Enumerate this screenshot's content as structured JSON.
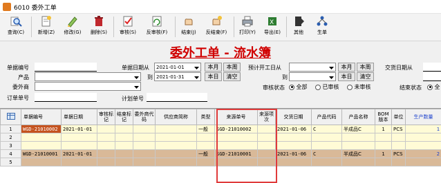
{
  "window": {
    "title": "6010 委外工单"
  },
  "toolbar": {
    "query": "查询(C)",
    "add": "新增(Z)",
    "edit": "修改(G)",
    "delete": "删除(S)",
    "audit": "审核(S)",
    "unaudit": "反审核(F)",
    "close": "结束(J)",
    "unclose": "反结束(F)",
    "print": "打印(Y)",
    "export": "导出(E)",
    "other": "其他",
    "generate": "生单"
  },
  "page_title": "委外工单 - 流水簿",
  "filters": {
    "order_no_label": "单据编号",
    "product_label": "产品",
    "vendor_label": "委外商",
    "sub_order_label": "订单单号",
    "date_from_label": "单据日期从",
    "date_from": "2021-01-01",
    "to_label": "到",
    "date_to": "2021-01-31",
    "this_month": "本月",
    "this_week": "本周",
    "today": "本日",
    "clear": "清空",
    "plan_no_label": "计划单号",
    "expected_start_label": "预计开工日从",
    "to_label2": "到",
    "this_month2": "本月",
    "this_week2": "本周",
    "today2": "本日",
    "clear2": "清空",
    "delivery_from_label": "交货日期从",
    "audit_status_label": "审核状态",
    "audit_options": [
      "全部",
      "已审核",
      "未审核"
    ],
    "close_status_label": "结束状态",
    "close_all": "全"
  },
  "grid": {
    "headers": [
      "单据编号",
      "单据日期",
      "审核标记",
      "结束标记",
      "委外商代码",
      "供应商简称",
      "类型",
      "来源单号",
      "来源项次",
      "交货日期",
      "产品代码",
      "产品名称",
      "BOM版本",
      "单位",
      "生产数量"
    ],
    "rows": [
      {
        "rn": "1",
        "order_no": "WGD-21010002",
        "date": "2021-01-01",
        "type": "一般",
        "source_no": "SGD-21010002",
        "delivery": "2021-01-06",
        "product_code": "C",
        "product_name": "半成品C",
        "bom": "1",
        "unit": "PCS",
        "qty": "1",
        "style": "yellow",
        "selected": true
      },
      {
        "rn": "2",
        "order_no": "",
        "date": "",
        "type": "",
        "source_no": "",
        "delivery": "",
        "product_code": "",
        "product_name": "",
        "bom": "",
        "unit": "",
        "qty": "",
        "style": "yellow",
        "selected": false
      },
      {
        "rn": "3",
        "order_no": "",
        "date": "",
        "type": "",
        "source_no": "",
        "delivery": "",
        "product_code": "",
        "product_name": "",
        "bom": "",
        "unit": "",
        "qty": "",
        "style": "yellow",
        "selected": false
      },
      {
        "rn": "4",
        "order_no": "WGD-21010001",
        "date": "2021-01-01",
        "type": "一般",
        "source_no": "SGD-21010001",
        "delivery": "2021-01-06",
        "product_code": "C",
        "product_name": "半成品C",
        "bom": "1",
        "unit": "PCS",
        "qty": "2",
        "style": "tan",
        "selected": false
      },
      {
        "rn": "5",
        "order_no": "",
        "date": "",
        "type": "",
        "source_no": "",
        "delivery": "",
        "product_code": "",
        "product_name": "",
        "bom": "",
        "unit": "",
        "qty": "",
        "style": "tan",
        "selected": false
      }
    ]
  },
  "colors": {
    "title_red": "#d00000",
    "highlight": "#e03a3a",
    "qty_blue": "#1a3fcc",
    "selected_cell": "#c5531f"
  }
}
